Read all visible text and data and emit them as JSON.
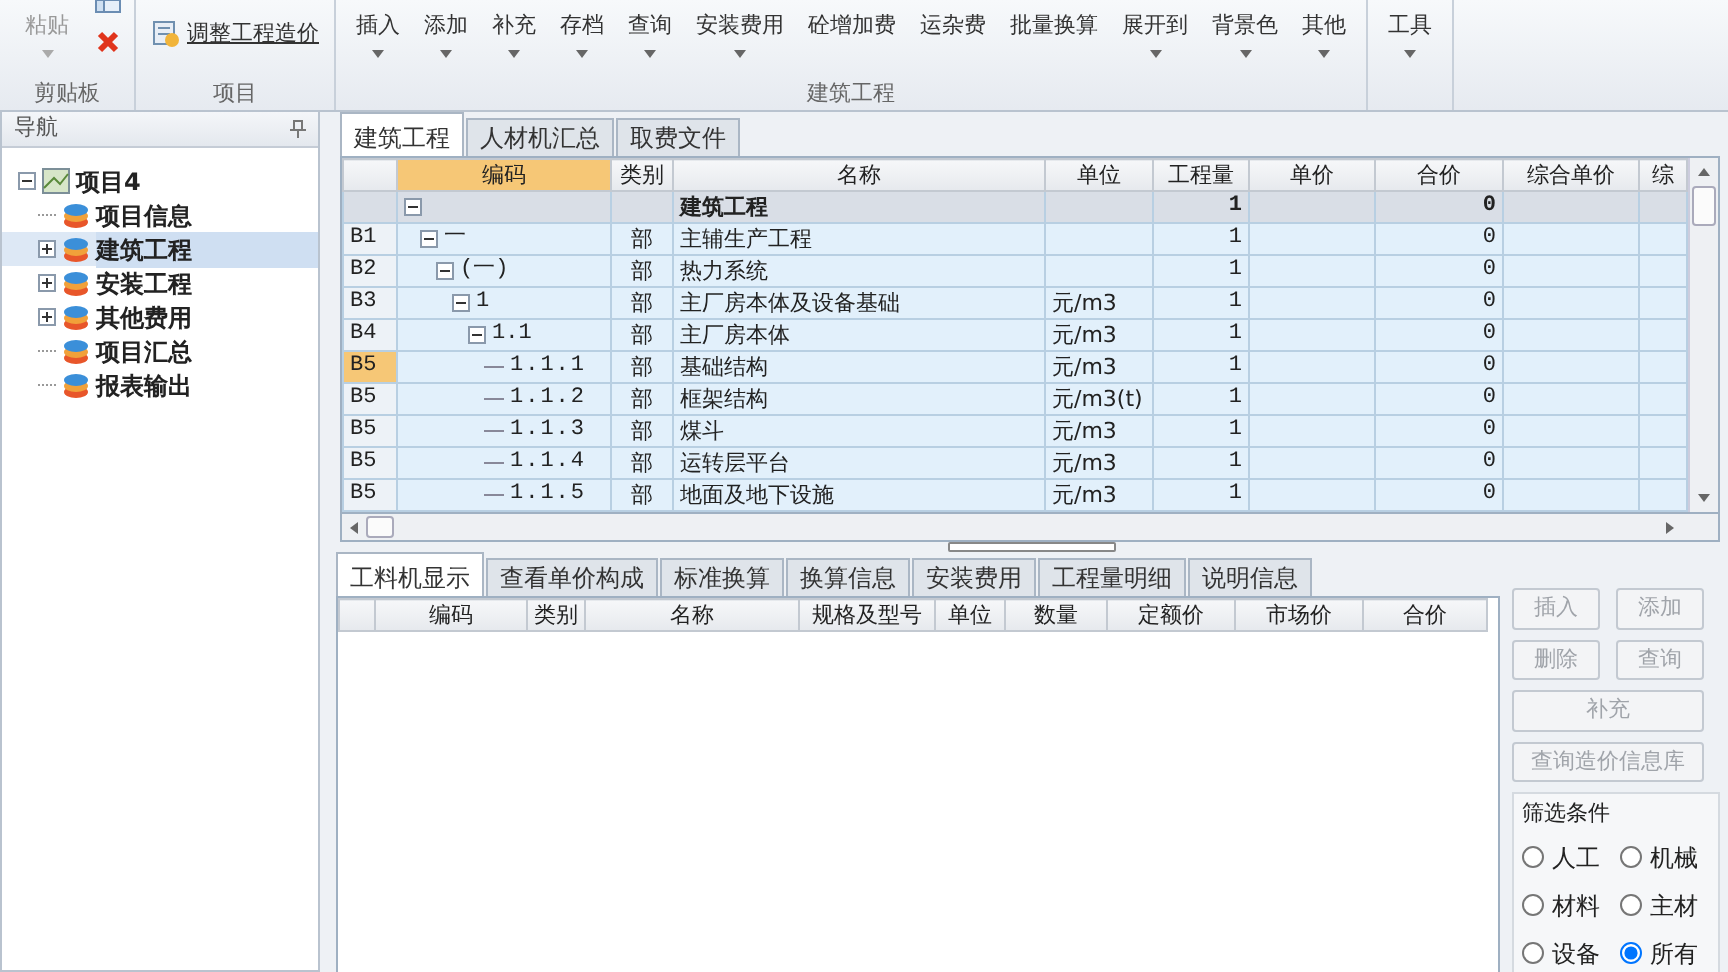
{
  "ribbon": {
    "groups": [
      {
        "kind": "clipboard",
        "label": "剪贴板",
        "paste": {
          "label": "粘贴",
          "disabled": true
        }
      },
      {
        "kind": "project",
        "label": "项目",
        "button": "调整工程造价"
      },
      {
        "kind": "commands",
        "label": "建筑工程",
        "buttons": [
          {
            "label": "插入",
            "dropdown": true
          },
          {
            "label": "添加",
            "dropdown": true
          },
          {
            "label": "补充",
            "dropdown": true
          },
          {
            "label": "存档",
            "dropdown": true
          },
          {
            "label": "查询",
            "dropdown": true
          },
          {
            "label": "安装费用",
            "dropdown": true
          },
          {
            "label": "砼增加费",
            "dropdown": false
          },
          {
            "label": "运杂费",
            "dropdown": false
          },
          {
            "label": "批量换算",
            "dropdown": false
          },
          {
            "label": "展开到",
            "dropdown": true
          },
          {
            "label": "背景色",
            "dropdown": true
          },
          {
            "label": "其他",
            "dropdown": true
          }
        ]
      },
      {
        "kind": "commands",
        "buttons": [
          {
            "label": "工具",
            "dropdown": true
          }
        ]
      }
    ]
  },
  "navigation": {
    "title": "导航",
    "tree": [
      {
        "label": "项目4",
        "kind": "project",
        "selected": false,
        "expandable": true,
        "expanded": true,
        "children": [
          {
            "label": "项目信息",
            "selected": false,
            "expandable": false
          },
          {
            "label": "建筑工程",
            "selected": true,
            "expandable": true,
            "expanded": false
          },
          {
            "label": "安装工程",
            "selected": false,
            "expandable": true,
            "expanded": false
          },
          {
            "label": "其他费用",
            "selected": false,
            "expandable": true,
            "expanded": false
          },
          {
            "label": "项目汇总",
            "selected": false,
            "expandable": false
          },
          {
            "label": "报表输出",
            "selected": false,
            "expandable": false
          }
        ]
      }
    ]
  },
  "main_table": {
    "tabs": [
      {
        "label": "建筑工程",
        "selected": true
      },
      {
        "label": "人材机汇总",
        "selected": false
      },
      {
        "label": "取费文件",
        "selected": false
      }
    ],
    "columns": [
      {
        "label": "编码",
        "selected": true
      },
      {
        "label": "类别",
        "selected": false
      },
      {
        "label": "名称",
        "selected": false
      },
      {
        "label": "单位",
        "selected": false
      },
      {
        "label": "工程量",
        "selected": false
      },
      {
        "label": "单价",
        "selected": false
      },
      {
        "label": "合价",
        "selected": false
      },
      {
        "label": "综合单价",
        "selected": false
      },
      {
        "label": "综",
        "selected": false
      }
    ],
    "rows": [
      {
        "kind": "summary",
        "name": "建筑工程",
        "quantity": "1",
        "total": "0",
        "selected": false,
        "expanded": true,
        "children": [
          {
            "row_header": "B1",
            "code": "一",
            "type": "部",
            "name": "主辅生产工程",
            "quantity": "1",
            "total": "0",
            "selected": false,
            "expanded": true,
            "children": [
              {
                "row_header": "B2",
                "code": "(一)",
                "type": "部",
                "name": "热力系统",
                "quantity": "1",
                "total": "0",
                "selected": false,
                "expanded": true,
                "children": [
                  {
                    "row_header": "B3",
                    "code": "1",
                    "type": "部",
                    "name": "主厂房本体及设备基础",
                    "unit": "元/m3",
                    "quantity": "1",
                    "total": "0",
                    "selected": false,
                    "expanded": true,
                    "children": [
                      {
                        "row_header": "B4",
                        "code": "1.1",
                        "type": "部",
                        "name": "主厂房本体",
                        "unit": "元/m3",
                        "quantity": "1",
                        "total": "0",
                        "selected": false,
                        "expanded": true,
                        "children": [
                          {
                            "row_header": "B5",
                            "code": "1.1.1",
                            "type": "部",
                            "name": "基础结构",
                            "unit": "元/m3",
                            "quantity": "1",
                            "total": "0",
                            "selected": true
                          },
                          {
                            "row_header": "B5",
                            "code": "1.1.2",
                            "type": "部",
                            "name": "框架结构",
                            "unit": "元/m3(t)",
                            "quantity": "1",
                            "total": "0",
                            "selected": false
                          },
                          {
                            "row_header": "B5",
                            "code": "1.1.3",
                            "type": "部",
                            "name": "煤斗",
                            "unit": "元/m3",
                            "quantity": "1",
                            "total": "0",
                            "selected": false
                          },
                          {
                            "row_header": "B5",
                            "code": "1.1.4",
                            "type": "部",
                            "name": "运转层平台",
                            "unit": "元/m3",
                            "quantity": "1",
                            "total": "0",
                            "selected": false
                          },
                          {
                            "row_header": "B5",
                            "code": "1.1.5",
                            "type": "部",
                            "name": "地面及地下设施",
                            "unit": "元/m3",
                            "quantity": "1",
                            "total": "0",
                            "selected": false
                          }
                        ]
                      }
                    ]
                  }
                ]
              }
            ]
          }
        ]
      }
    ]
  },
  "detail": {
    "tabs": [
      {
        "label": "工料机显示",
        "selected": true
      },
      {
        "label": "查看单价构成",
        "selected": false
      },
      {
        "label": "标准换算",
        "selected": false
      },
      {
        "label": "换算信息",
        "selected": false
      },
      {
        "label": "安装费用",
        "selected": false
      },
      {
        "label": "工程量明细",
        "selected": false
      },
      {
        "label": "说明信息",
        "selected": false
      }
    ],
    "columns": [
      "编码",
      "类别",
      "名称",
      "规格及型号",
      "单位",
      "数量",
      "定额价",
      "市场价",
      "合价"
    ],
    "buttons": [
      {
        "label": "插入",
        "disabled": true
      },
      {
        "label": "添加",
        "disabled": true
      },
      {
        "label": "删除",
        "disabled": true
      },
      {
        "label": "查询",
        "disabled": true
      },
      {
        "label": "补充",
        "disabled": true
      },
      {
        "label": "查询造价信息库",
        "disabled": true
      }
    ],
    "filter": {
      "title": "筛选条件",
      "options": [
        {
          "label": "人工",
          "selected": false
        },
        {
          "label": "机械",
          "selected": false
        },
        {
          "label": "材料",
          "selected": false
        },
        {
          "label": "主材",
          "selected": false
        },
        {
          "label": "设备",
          "selected": false
        },
        {
          "label": "所有",
          "selected": true
        }
      ]
    }
  }
}
